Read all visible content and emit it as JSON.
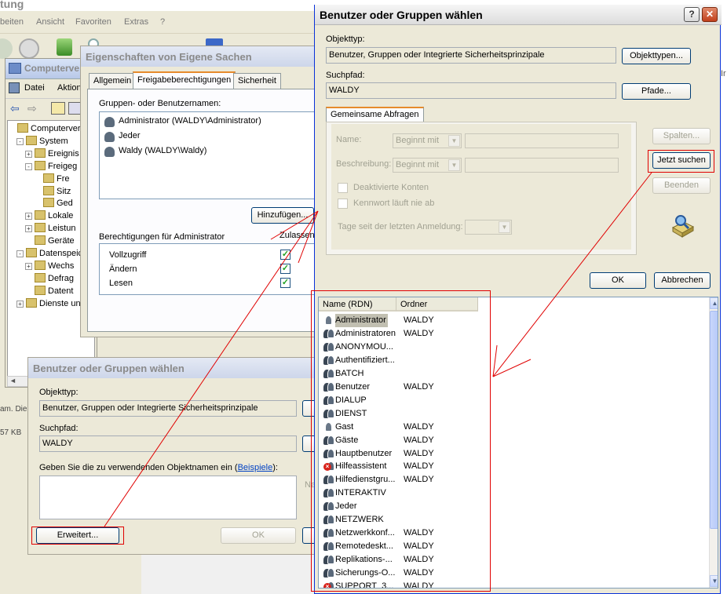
{
  "explorer": {
    "title_fragment": "tung",
    "menu": [
      "beiten",
      "Ansicht",
      "Favoriten",
      "Extras",
      "?"
    ],
    "status_fragments": [
      "am. Die",
      "57 KB"
    ],
    "right_fragment": "Ir"
  },
  "compmgmt": {
    "title": "Computerve",
    "menu": [
      "Datei",
      "Aktion"
    ],
    "tree": [
      {
        "label": "Computerverw",
        "level": 0,
        "exp": ""
      },
      {
        "label": "System",
        "level": 1,
        "exp": "-"
      },
      {
        "label": "Ereignis",
        "level": 2,
        "exp": "+"
      },
      {
        "label": "Freigeg",
        "level": 2,
        "exp": "-"
      },
      {
        "label": "Fre",
        "level": 3,
        "exp": ""
      },
      {
        "label": "Sitz",
        "level": 3,
        "exp": ""
      },
      {
        "label": "Ged",
        "level": 3,
        "exp": ""
      },
      {
        "label": "Lokale",
        "level": 2,
        "exp": "+"
      },
      {
        "label": "Leistun",
        "level": 2,
        "exp": "+"
      },
      {
        "label": "Geräte",
        "level": 2,
        "exp": ""
      },
      {
        "label": "Datenspeic",
        "level": 1,
        "exp": "-"
      },
      {
        "label": "Wechs",
        "level": 2,
        "exp": "+"
      },
      {
        "label": "Defrag",
        "level": 2,
        "exp": ""
      },
      {
        "label": "Datent",
        "level": 2,
        "exp": ""
      },
      {
        "label": "Dienste un",
        "level": 1,
        "exp": "+"
      }
    ]
  },
  "props": {
    "title": "Eigenschaften von Eigene Sachen",
    "tabs": [
      "Allgemein",
      "Freigabeberechtigungen",
      "Sicherheit"
    ],
    "groups_label": "Gruppen- oder Benutzernamen:",
    "users": [
      "Administrator (WALDY\\Administrator)",
      "Jeder",
      "Waldy (WALDY\\Waldy)"
    ],
    "add_button": "Hinzufügen...",
    "perms_label": "Berechtigungen für Administrator",
    "allow_label": "Zulassen",
    "perms": [
      "Vollzugriff",
      "Ändern",
      "Lesen"
    ]
  },
  "small": {
    "title": "Benutzer oder Gruppen wählen",
    "objtype_label": "Objekttyp:",
    "objtype_value": "Benutzer, Gruppen oder Integrierte Sicherheitsprinzipale",
    "path_label": "Suchpfad:",
    "path_value": "WALDY",
    "enter_label_pre": "Geben Sie die zu verwendenden Objektnamen ein (",
    "enter_label_link": "Beispiele",
    "enter_label_post": "):",
    "advanced_button": "Erweitert...",
    "ok_button": "OK",
    "names_fragment": "Na"
  },
  "main": {
    "title": "Benutzer oder Gruppen wählen",
    "help_glyph": "?",
    "close_glyph": "✕",
    "objtype_label": "Objekttyp:",
    "objtype_value": "Benutzer, Gruppen oder Integrierte Sicherheitsprinzipale",
    "objtype_button": "Objekttypen...",
    "path_label": "Suchpfad:",
    "path_value": "WALDY",
    "path_button": "Pfade...",
    "tab_label": "Gemeinsame Abfragen",
    "name_label": "Name:",
    "desc_label": "Beschreibung:",
    "starts_with": "Beginnt mit",
    "disabled_accounts": "Deaktivierte Konten",
    "no_expire": "Kennwort läuft nie ab",
    "days_label": "Tage seit der letzten Anmeldung:",
    "columns_button": "Spalten...",
    "search_button": "Jetzt suchen",
    "stop_button": "Beenden",
    "ok_button": "OK",
    "cancel_button": "Abbrechen",
    "col_name": "Name (RDN)",
    "col_folder": "Ordner",
    "results": [
      {
        "name": "Administrator",
        "folder": "WALDY",
        "icon": "user"
      },
      {
        "name": "Administratoren",
        "folder": "WALDY",
        "icon": "group"
      },
      {
        "name": "ANONYMOU...",
        "folder": "",
        "icon": "group"
      },
      {
        "name": "Authentifiziert...",
        "folder": "",
        "icon": "group"
      },
      {
        "name": "BATCH",
        "folder": "",
        "icon": "group"
      },
      {
        "name": "Benutzer",
        "folder": "WALDY",
        "icon": "group"
      },
      {
        "name": "DIALUP",
        "folder": "",
        "icon": "group"
      },
      {
        "name": "DIENST",
        "folder": "",
        "icon": "group"
      },
      {
        "name": "Gast",
        "folder": "WALDY",
        "icon": "user"
      },
      {
        "name": "Gäste",
        "folder": "WALDY",
        "icon": "group"
      },
      {
        "name": "Hauptbenutzer",
        "folder": "WALDY",
        "icon": "group"
      },
      {
        "name": "Hilfeassistent",
        "folder": "WALDY",
        "icon": "disabled"
      },
      {
        "name": "Hilfedienstgru...",
        "folder": "WALDY",
        "icon": "group"
      },
      {
        "name": "INTERAKTIV",
        "folder": "",
        "icon": "group"
      },
      {
        "name": "Jeder",
        "folder": "",
        "icon": "group"
      },
      {
        "name": "NETZWERK",
        "folder": "",
        "icon": "group"
      },
      {
        "name": "Netzwerkkonf...",
        "folder": "WALDY",
        "icon": "group"
      },
      {
        "name": "Remotedeskt...",
        "folder": "WALDY",
        "icon": "group"
      },
      {
        "name": "Replikations-...",
        "folder": "WALDY",
        "icon": "group"
      },
      {
        "name": "Sicherungs-O...",
        "folder": "WALDY",
        "icon": "group"
      },
      {
        "name": "SUPPORT_3...",
        "folder": "WALDY",
        "icon": "disabled"
      }
    ]
  },
  "colors": {
    "dialog_bg": "#ece9d8",
    "annotation": "#e00000",
    "selection": "#c1bfb1",
    "tab_accent": "#e68b2c"
  }
}
